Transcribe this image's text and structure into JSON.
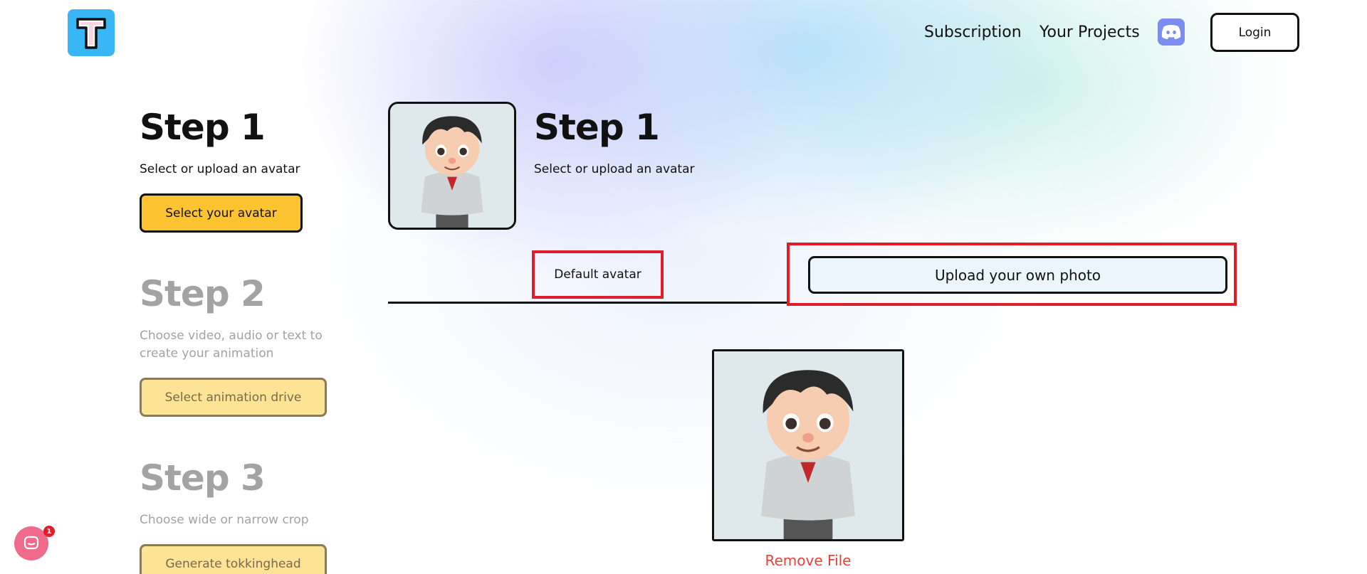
{
  "header": {
    "logo_letter": "T",
    "nav": {
      "subscription": "Subscription",
      "projects": "Your Projects"
    },
    "discord_icon": "discord-icon",
    "login_label": "Login"
  },
  "steps": [
    {
      "title": "Step 1",
      "subtitle": "Select or upload an avatar",
      "button": "Select your avatar",
      "state": "active"
    },
    {
      "title": "Step 2",
      "subtitle": "Choose video, audio or text to create your animation",
      "button": "Select animation drive",
      "state": "inactive"
    },
    {
      "title": "Step 3",
      "subtitle": "Choose wide or narrow crop",
      "button": "Generate tokkinghead",
      "state": "inactive"
    }
  ],
  "panel": {
    "title": "Step 1",
    "subtitle": "Select or upload an avatar",
    "tabs": {
      "default": "Default avatar",
      "upload": "Upload your own photo"
    },
    "remove_file": "Remove File"
  },
  "chat": {
    "badge": "1"
  },
  "colors": {
    "accent_yellow": "#fdc330",
    "logo_blue": "#38b6f5",
    "highlight_red": "#e11d2a",
    "remove_red": "#e8423e",
    "discord": "#7c8cf0"
  }
}
